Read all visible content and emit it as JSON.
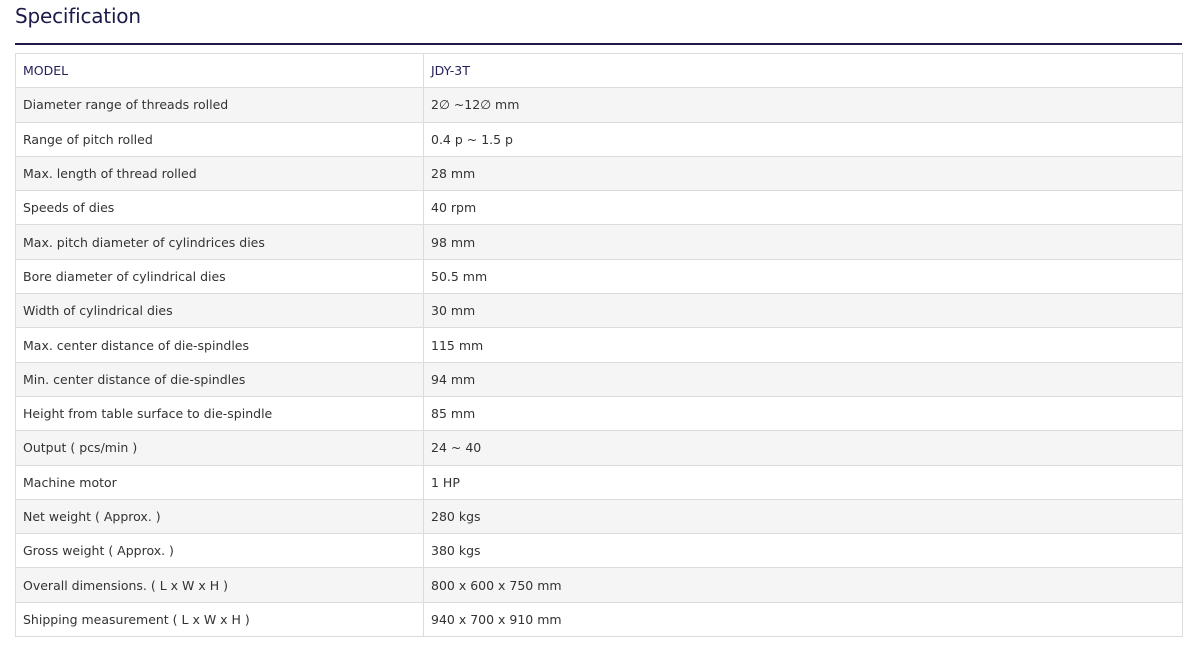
{
  "title": "Specification",
  "colors": {
    "title_text": "#1b1b4a",
    "rule": "#1e1a4c",
    "header_text": "#24205a",
    "body_text": "#333333",
    "stripe": "#f5f5f5",
    "border": "#dcdcdc"
  },
  "table": {
    "header": {
      "label": "MODEL",
      "value": "JDY-3T"
    },
    "rows": [
      {
        "label": "Diameter range of threads rolled",
        "value": "2∅ ~12∅ mm"
      },
      {
        "label": "Range of pitch rolled",
        "value": "0.4 p ~ 1.5 p"
      },
      {
        "label": "Max. length of thread rolled",
        "value": "28 mm"
      },
      {
        "label": "Speeds of dies",
        "value": "40 rpm"
      },
      {
        "label": "Max. pitch diameter of cylindrices dies",
        "value": "98 mm"
      },
      {
        "label": "Bore diameter of cylindrical dies",
        "value": "50.5 mm"
      },
      {
        "label": "Width of cylindrical dies",
        "value": "30 mm"
      },
      {
        "label": "Max. center distance of die-spindles",
        "value": "115 mm"
      },
      {
        "label": "Min. center distance of die-spindles",
        "value": "94 mm"
      },
      {
        "label": "Height from table surface to die-spindle",
        "value": "85 mm"
      },
      {
        "label": "Output ( pcs/min )",
        "value": "24 ~ 40"
      },
      {
        "label": "Machine motor",
        "value": "1 HP"
      },
      {
        "label": "Net weight ( Approx. )",
        "value": "280 kgs"
      },
      {
        "label": "Gross weight ( Approx. )",
        "value": "380 kgs"
      },
      {
        "label": "Overall dimensions. ( L x W x H )",
        "value": "800 x 600 x 750 mm"
      },
      {
        "label": "Shipping measurement ( L x W x H )",
        "value": "940 x 700 x 910 mm"
      }
    ]
  }
}
